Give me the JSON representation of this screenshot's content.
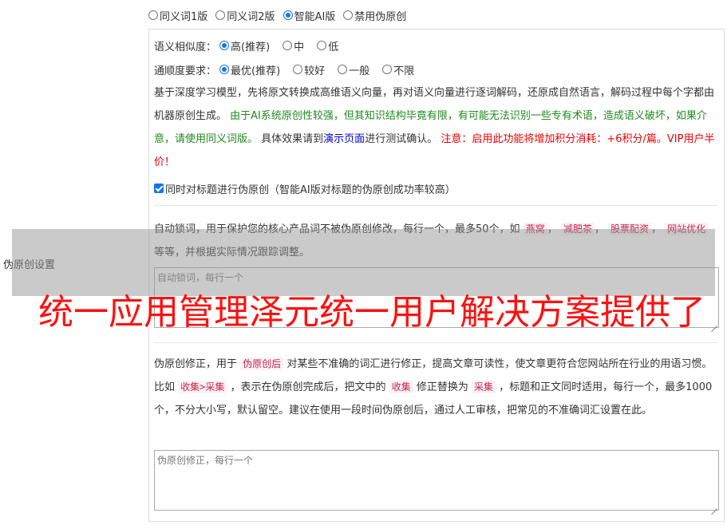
{
  "mode_options": [
    {
      "label": "同义词1版",
      "checked": false
    },
    {
      "label": "同义词2版",
      "checked": false
    },
    {
      "label": "智能AI版",
      "checked": true
    },
    {
      "label": "禁用伪原创",
      "checked": false
    }
  ],
  "section_label": "伪原创设置",
  "similarity": {
    "label": "语义相似度：",
    "options": [
      {
        "label": "高(推荐)",
        "checked": true
      },
      {
        "label": "中",
        "checked": false
      },
      {
        "label": "低",
        "checked": false
      }
    ]
  },
  "fluency": {
    "label": "通顺度要求：",
    "options": [
      {
        "label": "最优(推荐)",
        "checked": true
      },
      {
        "label": "较好",
        "checked": false
      },
      {
        "label": "一般",
        "checked": false
      },
      {
        "label": "不限",
        "checked": false
      }
    ]
  },
  "ai_desc": {
    "part1": "基于深度学习模型，先将原文转换成高维语义向量，再对语义向量进行逐词解码，还原成自然语言，解码过程中每个字都由机器原创生成。",
    "green": "由于AI系统原创性较强，但其知识结构毕竟有限，有可能无法识别一些专有术语，造成语义破坏，如果介意，请使用同义词版。",
    "part2": "具体效果请到",
    "link": "演示页面",
    "part3": "进行测试确认。",
    "red": "注意：启用此功能将增加积分消耗：+6积分/篇。VIP用户半价！"
  },
  "title_checkbox": {
    "label": "同时对标题进行伪原创（智能AI版对标题的伪原创成功率较高）",
    "checked": true
  },
  "lock_words": {
    "desc1": "自动锁词，用于保护您的核心产品词不被伪原创修改，每行一个，最多50个，如",
    "kw1": "燕窝",
    "sep1": "，",
    "kw2": "减肥茶",
    "sep2": "，",
    "kw3": "股票配资",
    "sep3": "，",
    "kw4": "网站优化",
    "desc2": "等等，并根据实际情况跟踪调整。",
    "placeholder": "自动锁词，每行一个"
  },
  "correction": {
    "desc1": "伪原创修正，用于",
    "kw1": "伪原创后",
    "desc2": "对某些不准确的词汇进行修正，提高文章可读性，使文章更符合您网站所在行业的用语习惯。比如",
    "kw2": "收集>采集",
    "desc3": "，表示在伪原创完成后，把文中的",
    "kw3": "收集",
    "desc4": "修正替换为",
    "kw4": "采集",
    "desc5": "，标题和正文同时适用，每行一个，最多1000个，不分大小写，默认留空。建议在使用一段时间伪原创后，通过人工审核，把常见的不准确词汇设置在此。",
    "placeholder": "伪原创修正，每行一个"
  },
  "watermark": "统一应用管理泽元统一用户解决方案提供了",
  "colors": {
    "accent": "#1a73e8",
    "green_text": "#1e8a1e",
    "red_text": "#e60000",
    "link": "#0000cc",
    "keyword": "#c7254e",
    "watermark": "#ff1010"
  }
}
